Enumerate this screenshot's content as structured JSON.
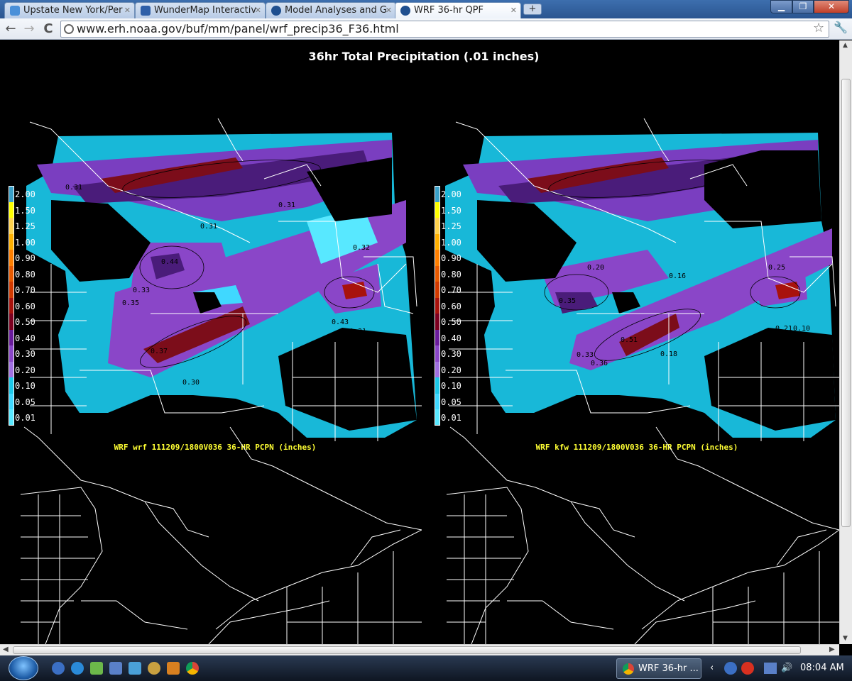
{
  "browser": {
    "tabs": [
      {
        "title": "Upstate New York/Per",
        "icon_color": "#4a90d9"
      },
      {
        "title": "WunderMap Interactiv",
        "icon_color": "#2e5fa8"
      },
      {
        "title": "Model Analyses and G",
        "icon_color": "#1f4f8f"
      },
      {
        "title": "WRF 36-hr QPF",
        "icon_color": "#1f4f8f"
      }
    ],
    "new_tab": "+",
    "url": "www.erh.noaa.gov/buf/mm/panel/wrf_precip36_F36.html",
    "back": "←",
    "forward": "→",
    "reload": "C",
    "star": "☆",
    "wrench": "🔧",
    "minimize": "▁",
    "maximize": "❐",
    "close": "✕"
  },
  "page": {
    "title": "36hr Total Precipitation (.01 inches)",
    "legend": {
      "labels": [
        "2.00",
        "1.50",
        "1.25",
        "1.00",
        "0.90",
        "0.80",
        "0.70",
        "0.60",
        "0.50",
        "0.40",
        "0.30",
        "0.20",
        "0.10",
        "0.05",
        "0.01"
      ],
      "colors": [
        "#3aa0c8",
        "#ffff00",
        "#ffd24d",
        "#ffb000",
        "#ff7f00",
        "#e85a00",
        "#d23a00",
        "#a8120c",
        "#7c0020",
        "#6a1c9c",
        "#8a46c8",
        "#a070e0",
        "#1cc8e8",
        "#40d8ff",
        "#58e8ff"
      ]
    },
    "panels": [
      {
        "caption": "WRF wrf  111209/1800V036 36-HR PCPN (inches)",
        "labels": [
          "0.31",
          "0.31",
          "0.31",
          "0.44",
          "0.33",
          "0.35",
          "0.37",
          "0.30",
          "0.43",
          "0.31",
          "0.32"
        ]
      },
      {
        "caption": "WRF kfw  111209/1800V036 36-HR PCPN (inches)",
        "labels": [
          "0.20",
          "0.16",
          "0.35",
          "0.33",
          "0.36",
          "0.18",
          "0.51",
          "0.25",
          "0.21",
          "0.10"
        ]
      }
    ]
  },
  "taskbar": {
    "chrome_task": "WRF 36-hr ...",
    "clock": "08:04 AM"
  }
}
